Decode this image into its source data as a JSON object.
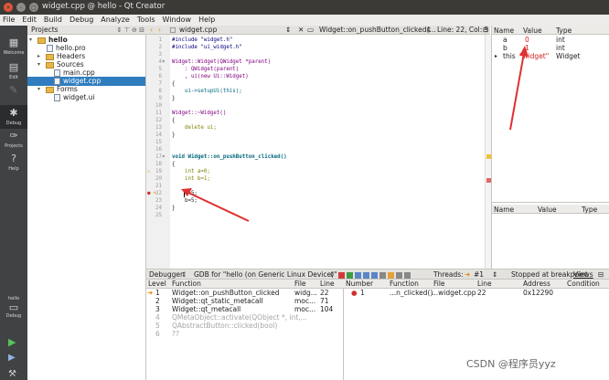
{
  "window": {
    "title": "widget.cpp @ hello - Qt Creator"
  },
  "menu": [
    "File",
    "Edit",
    "Build",
    "Debug",
    "Analyze",
    "Tools",
    "Window",
    "Help"
  ],
  "modes": [
    {
      "label": "Welcome",
      "icon": "grid-icon"
    },
    {
      "label": "Edit",
      "icon": "document-icon"
    },
    {
      "label": "",
      "icon": "pencil-icon"
    },
    {
      "label": "Debug",
      "icon": "bug-icon"
    },
    {
      "label": "Projects",
      "icon": "wrench-icon"
    },
    {
      "label": "Help",
      "icon": "help-icon"
    }
  ],
  "kit": {
    "project": "hello",
    "mode": "Debug"
  },
  "projects": {
    "title": "Projects",
    "tree": [
      {
        "label": "hello",
        "kind": "folder",
        "level": 0,
        "open": true
      },
      {
        "label": "hello.pro",
        "kind": "file",
        "level": 1
      },
      {
        "label": "Headers",
        "kind": "folder",
        "level": 1,
        "open": false
      },
      {
        "label": "Sources",
        "kind": "folder",
        "level": 1,
        "open": true
      },
      {
        "label": "main.cpp",
        "kind": "file",
        "level": 2
      },
      {
        "label": "widget.cpp",
        "kind": "file",
        "level": 2,
        "selected": true
      },
      {
        "label": "Forms",
        "kind": "folder",
        "level": 1,
        "open": true
      },
      {
        "label": "widget.ui",
        "kind": "file",
        "level": 2
      }
    ]
  },
  "editor": {
    "file": "widget.cpp",
    "symbol": "Widget::on_pushButton_clicked(...",
    "position": "Line: 22, Col: 5",
    "lines": [
      {
        "n": "1",
        "text": "#include \"widget.h\""
      },
      {
        "n": "2",
        "text": "#include \"ui_widget.h\""
      },
      {
        "n": "3",
        "text": ""
      },
      {
        "n": "4",
        "text": "Widget::Widget(QWidget *parent)"
      },
      {
        "n": "5",
        "text": "    : QWidget(parent)"
      },
      {
        "n": "6",
        "text": "    , ui(new Ui::Widget)"
      },
      {
        "n": "7",
        "text": "{"
      },
      {
        "n": "8",
        "text": "    ui->setupUi(this);"
      },
      {
        "n": "9",
        "text": "}"
      },
      {
        "n": "10",
        "text": ""
      },
      {
        "n": "11",
        "text": "Widget::~Widget()"
      },
      {
        "n": "12",
        "text": "{"
      },
      {
        "n": "13",
        "text": "    delete ui;"
      },
      {
        "n": "14",
        "text": "}"
      },
      {
        "n": "15",
        "text": ""
      },
      {
        "n": "16",
        "text": ""
      },
      {
        "n": "17",
        "text": "void Widget::on_pushButton_clicked()"
      },
      {
        "n": "18",
        "text": "{"
      },
      {
        "n": "19",
        "text": "    int a=0;"
      },
      {
        "n": "20",
        "text": "    int b=1;"
      },
      {
        "n": "21",
        "text": ""
      },
      {
        "n": "22",
        "text": "    a=5;"
      },
      {
        "n": "23",
        "text": "    b=5;"
      },
      {
        "n": "24",
        "text": "}"
      },
      {
        "n": "25",
        "text": ""
      }
    ]
  },
  "locals": {
    "headers": [
      "Name",
      "Value",
      "Type"
    ],
    "rows": [
      {
        "name": "a",
        "value": "0",
        "type": "int",
        "changed": true
      },
      {
        "name": "b",
        "value": "1",
        "type": "int",
        "changed": true
      },
      {
        "name": "this",
        "value": "\"widget\"",
        "type": "Widget",
        "changed": true
      }
    ]
  },
  "watch": {
    "headers": [
      "Name",
      "Value",
      "Type"
    ]
  },
  "debugger": {
    "label": "Debugger",
    "engine": "GDB for \"hello (on Generic Linux Device)\"",
    "threads_label": "Threads:",
    "thread": "#1",
    "status": "Stopped at breakpoint",
    "views": "Views"
  },
  "stack": {
    "headers": [
      "Level",
      "Function",
      "File",
      "Line"
    ],
    "rows": [
      {
        "level": "1",
        "function": "Widget::on_pushButton_clicked",
        "file": "widg...",
        "line": "22",
        "current": true
      },
      {
        "level": "2",
        "function": "Widget::qt_static_metacall",
        "file": "moc...",
        "line": "71"
      },
      {
        "level": "3",
        "function": "Widget::qt_metacall",
        "file": "moc...",
        "line": "104"
      },
      {
        "level": "4",
        "function": "QMetaObject::activate(QObject *, int,...",
        "file": "",
        "line": "",
        "dim": true
      },
      {
        "level": "5",
        "function": "QAbstractButton::clicked(bool)",
        "file": "",
        "line": "",
        "dim": true
      },
      {
        "level": "6",
        "function": "??",
        "file": "",
        "line": "",
        "dim": true
      }
    ]
  },
  "breakpoints": {
    "headers": [
      "Number",
      "Function",
      "File",
      "Line",
      "Address",
      "Condition"
    ],
    "rows": [
      {
        "number": "1",
        "function": "...n_clicked()",
        "file": "...widget.cpp",
        "line": "22",
        "address": "0x12290",
        "condition": ""
      }
    ]
  },
  "watermark": "CSDN @程序员yyz",
  "colors": {
    "changed_value": "#d02020",
    "selection": "#2f7dbf",
    "annotation_arrow": "#e03030"
  }
}
